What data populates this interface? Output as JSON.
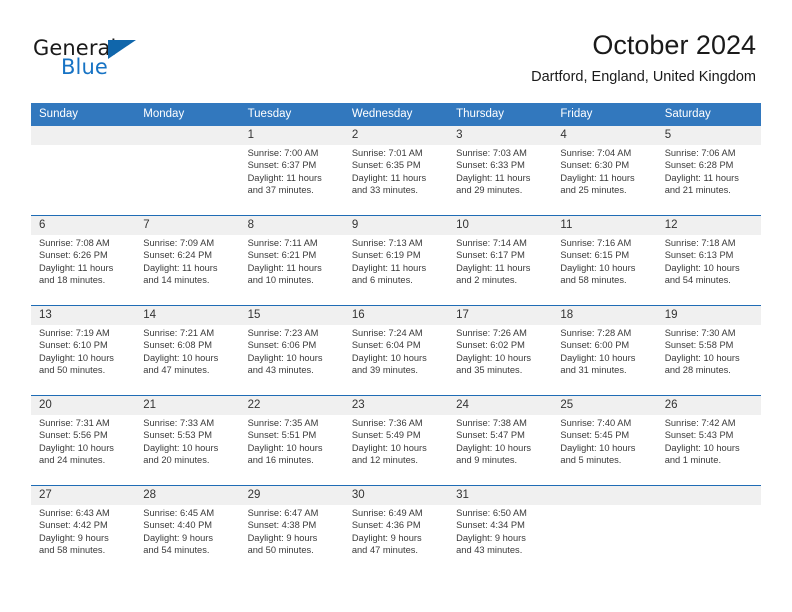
{
  "brand": {
    "name_part1": "General",
    "name_part2": "Blue"
  },
  "header": {
    "title": "October 2024",
    "subtitle": "Dartford, England, United Kingdom"
  },
  "theme": {
    "header_blue": "#3278be",
    "rule_blue": "#1f6cb5",
    "daynum_bg": "#f0f0f0",
    "logo_blue": "#1773c4"
  },
  "weekday_headers": [
    "Sunday",
    "Monday",
    "Tuesday",
    "Wednesday",
    "Thursday",
    "Friday",
    "Saturday"
  ],
  "weeks": [
    {
      "days": [
        {
          "num": "",
          "sunrise": "",
          "sunset": "",
          "daylight_1": "",
          "daylight_2": ""
        },
        {
          "num": "",
          "sunrise": "",
          "sunset": "",
          "daylight_1": "",
          "daylight_2": ""
        },
        {
          "num": "1",
          "sunrise": "Sunrise: 7:00 AM",
          "sunset": "Sunset: 6:37 PM",
          "daylight_1": "Daylight: 11 hours",
          "daylight_2": "and 37 minutes."
        },
        {
          "num": "2",
          "sunrise": "Sunrise: 7:01 AM",
          "sunset": "Sunset: 6:35 PM",
          "daylight_1": "Daylight: 11 hours",
          "daylight_2": "and 33 minutes."
        },
        {
          "num": "3",
          "sunrise": "Sunrise: 7:03 AM",
          "sunset": "Sunset: 6:33 PM",
          "daylight_1": "Daylight: 11 hours",
          "daylight_2": "and 29 minutes."
        },
        {
          "num": "4",
          "sunrise": "Sunrise: 7:04 AM",
          "sunset": "Sunset: 6:30 PM",
          "daylight_1": "Daylight: 11 hours",
          "daylight_2": "and 25 minutes."
        },
        {
          "num": "5",
          "sunrise": "Sunrise: 7:06 AM",
          "sunset": "Sunset: 6:28 PM",
          "daylight_1": "Daylight: 11 hours",
          "daylight_2": "and 21 minutes."
        }
      ]
    },
    {
      "days": [
        {
          "num": "6",
          "sunrise": "Sunrise: 7:08 AM",
          "sunset": "Sunset: 6:26 PM",
          "daylight_1": "Daylight: 11 hours",
          "daylight_2": "and 18 minutes."
        },
        {
          "num": "7",
          "sunrise": "Sunrise: 7:09 AM",
          "sunset": "Sunset: 6:24 PM",
          "daylight_1": "Daylight: 11 hours",
          "daylight_2": "and 14 minutes."
        },
        {
          "num": "8",
          "sunrise": "Sunrise: 7:11 AM",
          "sunset": "Sunset: 6:21 PM",
          "daylight_1": "Daylight: 11 hours",
          "daylight_2": "and 10 minutes."
        },
        {
          "num": "9",
          "sunrise": "Sunrise: 7:13 AM",
          "sunset": "Sunset: 6:19 PM",
          "daylight_1": "Daylight: 11 hours",
          "daylight_2": "and 6 minutes."
        },
        {
          "num": "10",
          "sunrise": "Sunrise: 7:14 AM",
          "sunset": "Sunset: 6:17 PM",
          "daylight_1": "Daylight: 11 hours",
          "daylight_2": "and 2 minutes."
        },
        {
          "num": "11",
          "sunrise": "Sunrise: 7:16 AM",
          "sunset": "Sunset: 6:15 PM",
          "daylight_1": "Daylight: 10 hours",
          "daylight_2": "and 58 minutes."
        },
        {
          "num": "12",
          "sunrise": "Sunrise: 7:18 AM",
          "sunset": "Sunset: 6:13 PM",
          "daylight_1": "Daylight: 10 hours",
          "daylight_2": "and 54 minutes."
        }
      ]
    },
    {
      "days": [
        {
          "num": "13",
          "sunrise": "Sunrise: 7:19 AM",
          "sunset": "Sunset: 6:10 PM",
          "daylight_1": "Daylight: 10 hours",
          "daylight_2": "and 50 minutes."
        },
        {
          "num": "14",
          "sunrise": "Sunrise: 7:21 AM",
          "sunset": "Sunset: 6:08 PM",
          "daylight_1": "Daylight: 10 hours",
          "daylight_2": "and 47 minutes."
        },
        {
          "num": "15",
          "sunrise": "Sunrise: 7:23 AM",
          "sunset": "Sunset: 6:06 PM",
          "daylight_1": "Daylight: 10 hours",
          "daylight_2": "and 43 minutes."
        },
        {
          "num": "16",
          "sunrise": "Sunrise: 7:24 AM",
          "sunset": "Sunset: 6:04 PM",
          "daylight_1": "Daylight: 10 hours",
          "daylight_2": "and 39 minutes."
        },
        {
          "num": "17",
          "sunrise": "Sunrise: 7:26 AM",
          "sunset": "Sunset: 6:02 PM",
          "daylight_1": "Daylight: 10 hours",
          "daylight_2": "and 35 minutes."
        },
        {
          "num": "18",
          "sunrise": "Sunrise: 7:28 AM",
          "sunset": "Sunset: 6:00 PM",
          "daylight_1": "Daylight: 10 hours",
          "daylight_2": "and 31 minutes."
        },
        {
          "num": "19",
          "sunrise": "Sunrise: 7:30 AM",
          "sunset": "Sunset: 5:58 PM",
          "daylight_1": "Daylight: 10 hours",
          "daylight_2": "and 28 minutes."
        }
      ]
    },
    {
      "days": [
        {
          "num": "20",
          "sunrise": "Sunrise: 7:31 AM",
          "sunset": "Sunset: 5:56 PM",
          "daylight_1": "Daylight: 10 hours",
          "daylight_2": "and 24 minutes."
        },
        {
          "num": "21",
          "sunrise": "Sunrise: 7:33 AM",
          "sunset": "Sunset: 5:53 PM",
          "daylight_1": "Daylight: 10 hours",
          "daylight_2": "and 20 minutes."
        },
        {
          "num": "22",
          "sunrise": "Sunrise: 7:35 AM",
          "sunset": "Sunset: 5:51 PM",
          "daylight_1": "Daylight: 10 hours",
          "daylight_2": "and 16 minutes."
        },
        {
          "num": "23",
          "sunrise": "Sunrise: 7:36 AM",
          "sunset": "Sunset: 5:49 PM",
          "daylight_1": "Daylight: 10 hours",
          "daylight_2": "and 12 minutes."
        },
        {
          "num": "24",
          "sunrise": "Sunrise: 7:38 AM",
          "sunset": "Sunset: 5:47 PM",
          "daylight_1": "Daylight: 10 hours",
          "daylight_2": "and 9 minutes."
        },
        {
          "num": "25",
          "sunrise": "Sunrise: 7:40 AM",
          "sunset": "Sunset: 5:45 PM",
          "daylight_1": "Daylight: 10 hours",
          "daylight_2": "and 5 minutes."
        },
        {
          "num": "26",
          "sunrise": "Sunrise: 7:42 AM",
          "sunset": "Sunset: 5:43 PM",
          "daylight_1": "Daylight: 10 hours",
          "daylight_2": "and 1 minute."
        }
      ]
    },
    {
      "days": [
        {
          "num": "27",
          "sunrise": "Sunrise: 6:43 AM",
          "sunset": "Sunset: 4:42 PM",
          "daylight_1": "Daylight: 9 hours",
          "daylight_2": "and 58 minutes."
        },
        {
          "num": "28",
          "sunrise": "Sunrise: 6:45 AM",
          "sunset": "Sunset: 4:40 PM",
          "daylight_1": "Daylight: 9 hours",
          "daylight_2": "and 54 minutes."
        },
        {
          "num": "29",
          "sunrise": "Sunrise: 6:47 AM",
          "sunset": "Sunset: 4:38 PM",
          "daylight_1": "Daylight: 9 hours",
          "daylight_2": "and 50 minutes."
        },
        {
          "num": "30",
          "sunrise": "Sunrise: 6:49 AM",
          "sunset": "Sunset: 4:36 PM",
          "daylight_1": "Daylight: 9 hours",
          "daylight_2": "and 47 minutes."
        },
        {
          "num": "31",
          "sunrise": "Sunrise: 6:50 AM",
          "sunset": "Sunset: 4:34 PM",
          "daylight_1": "Daylight: 9 hours",
          "daylight_2": "and 43 minutes."
        },
        {
          "num": "",
          "sunrise": "",
          "sunset": "",
          "daylight_1": "",
          "daylight_2": ""
        },
        {
          "num": "",
          "sunrise": "",
          "sunset": "",
          "daylight_1": "",
          "daylight_2": ""
        }
      ]
    }
  ]
}
